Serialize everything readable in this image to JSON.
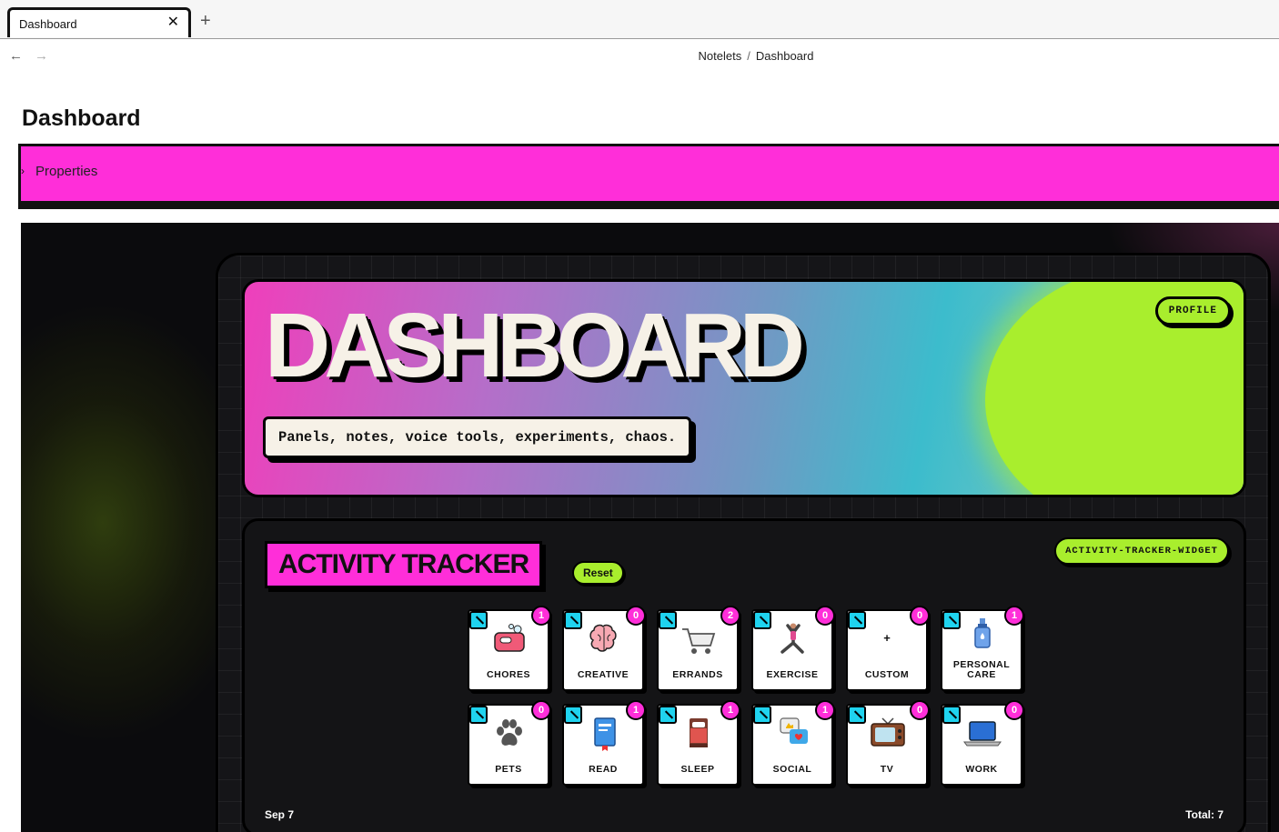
{
  "tab": {
    "title": "Dashboard",
    "close_icon": "close-icon",
    "new_tab_icon": "plus-icon"
  },
  "nav": {
    "back_icon": "arrow-left-icon",
    "forward_icon": "arrow-right-icon",
    "breadcrumb": [
      "Notelets",
      "Dashboard"
    ]
  },
  "page": {
    "title": "Dashboard"
  },
  "properties": {
    "label": "Properties"
  },
  "hero": {
    "title": "DASHBOARD",
    "subtitle": "Panels, notes, voice tools, experiments, chaos.",
    "profile": "PROFILE"
  },
  "tracker": {
    "title": "ACTIVITY TRACKER",
    "reset": "Reset",
    "widget": "ACTIVITY-TRACKER-WIDGET",
    "date": "Sep 7",
    "total": "Total: 7",
    "activities": [
      {
        "label": "CHORES",
        "count": "1",
        "icon": "sponge-icon"
      },
      {
        "label": "CREATIVE",
        "count": "0",
        "icon": "brain-icon"
      },
      {
        "label": "ERRANDS",
        "count": "2",
        "icon": "shopping-cart-icon"
      },
      {
        "label": "EXERCISE",
        "count": "0",
        "icon": "yoga-icon"
      },
      {
        "label": "CUSTOM",
        "count": "0",
        "icon": "plus-icon"
      },
      {
        "label": "PERSONAL CARE",
        "count": "1",
        "icon": "lotion-bottle-icon"
      },
      {
        "label": "PETS",
        "count": "0",
        "icon": "paw-icon"
      },
      {
        "label": "READ",
        "count": "1",
        "icon": "book-icon"
      },
      {
        "label": "SLEEP",
        "count": "1",
        "icon": "bed-icon"
      },
      {
        "label": "SOCIAL",
        "count": "1",
        "icon": "chat-bubbles-icon"
      },
      {
        "label": "TV",
        "count": "0",
        "icon": "tv-icon"
      },
      {
        "label": "WORK",
        "count": "0",
        "icon": "laptop-icon"
      }
    ]
  },
  "colors": {
    "accent_pink": "#ff2ed9",
    "accent_lime": "#a9ee2d",
    "edit_cyan": "#1fd3ef"
  }
}
